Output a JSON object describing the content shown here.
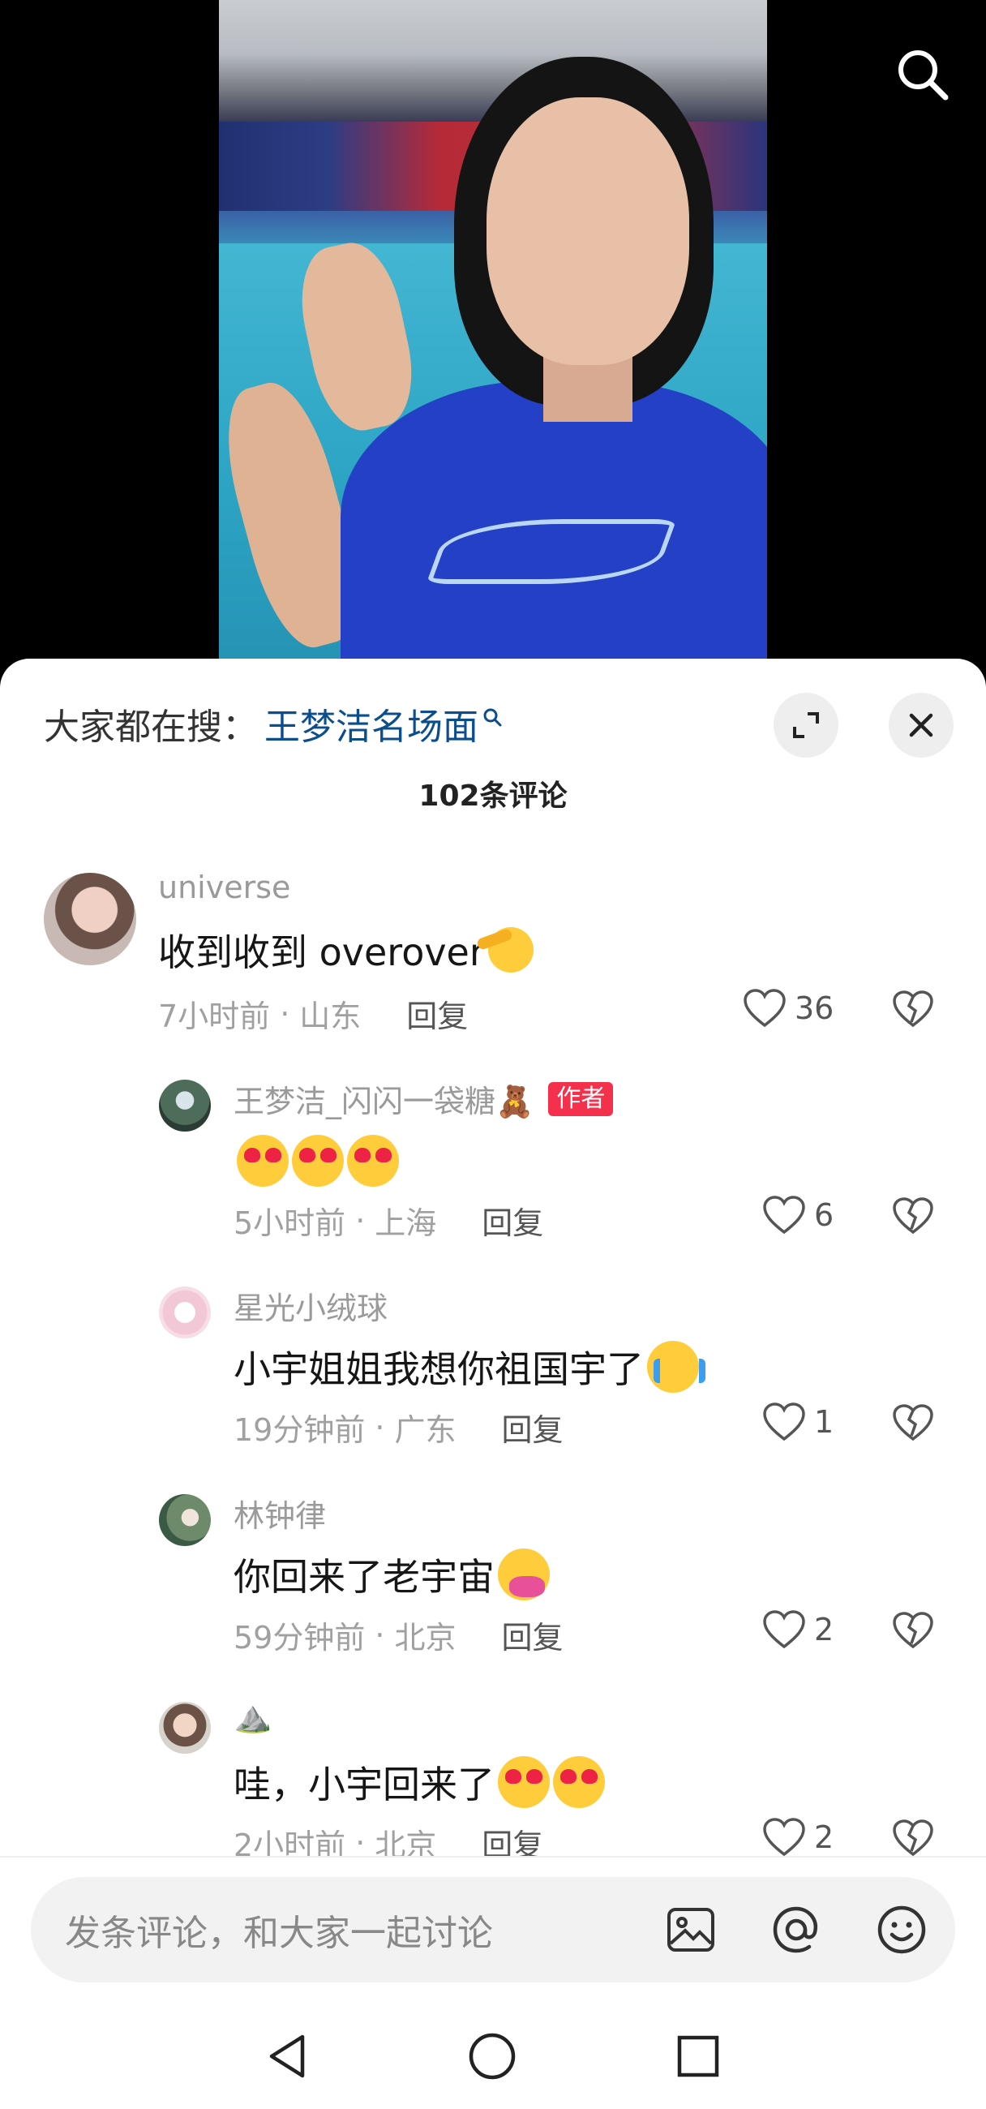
{
  "hot_search": {
    "prefix": "大家都在搜：",
    "term": "王梦洁名场面"
  },
  "comment_count_title": "102条评论",
  "comments": [
    {
      "user": "universe",
      "text": "收到收到 overover",
      "time": "7小时前",
      "location": "山东",
      "reply": "回复",
      "likes": "36"
    },
    {
      "user": "王梦洁_闪闪一袋糖🧸",
      "badge": "作者",
      "text": "",
      "time": "5小时前",
      "location": "上海",
      "reply": "回复",
      "likes": "6"
    },
    {
      "user": "星光小绒球",
      "text": "小宇姐姐我想你祖国宇了",
      "time": "19分钟前",
      "location": "广东",
      "reply": "回复",
      "likes": "1"
    },
    {
      "user": "林钟律",
      "text": "你回来了老宇宙",
      "time": "59分钟前",
      "location": "北京",
      "reply": "回复",
      "likes": "2"
    },
    {
      "user": "⛰️",
      "text": "哇，小宇回来了",
      "time": "2小时前",
      "location": "北京",
      "reply": "回复",
      "likes": "2"
    }
  ],
  "meta_separator": "·",
  "input": {
    "placeholder": "发条评论，和大家一起讨论"
  },
  "colors": {
    "accent": "#0c4d8c",
    "badge": "#f5304c"
  },
  "icons": [
    "search-icon",
    "expand-icon",
    "close-icon",
    "heart-icon",
    "dislike-icon",
    "image-icon",
    "at-icon",
    "emoji-icon",
    "back-icon",
    "home-icon",
    "recents-icon"
  ]
}
